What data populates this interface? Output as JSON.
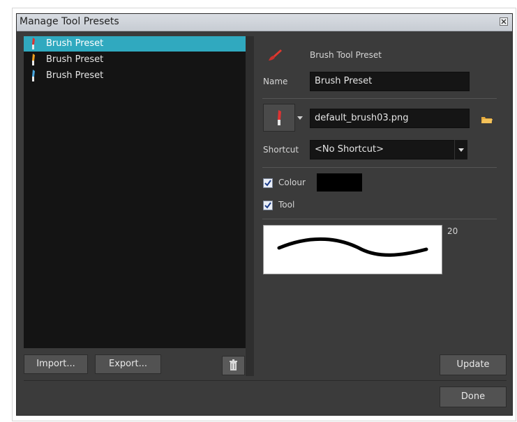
{
  "window": {
    "title": "Manage Tool Presets"
  },
  "presets": [
    {
      "label": "Brush Preset",
      "selected": true,
      "icon": "brush-red-icon"
    },
    {
      "label": "Brush Preset",
      "selected": false,
      "icon": "brush-orange-icon"
    },
    {
      "label": "Brush Preset",
      "selected": false,
      "icon": "brush-blue-icon"
    }
  ],
  "buttons": {
    "import": "Import...",
    "export": "Export...",
    "update": "Update",
    "done": "Done"
  },
  "detail": {
    "header": "Brush Tool Preset",
    "name_label": "Name",
    "name_value": "Brush Preset",
    "tip_file": "default_brush03.png",
    "shortcut_label": "Shortcut",
    "shortcut_value": "<No Shortcut>",
    "colour_label": "Colour",
    "colour_checked": true,
    "colour_swatch": "#000000",
    "tool_label": "Tool",
    "tool_checked": true,
    "size": "20"
  },
  "colors": {
    "selection": "#30a9bf",
    "panel": "#3b3b3b",
    "list_bg": "#141414"
  }
}
